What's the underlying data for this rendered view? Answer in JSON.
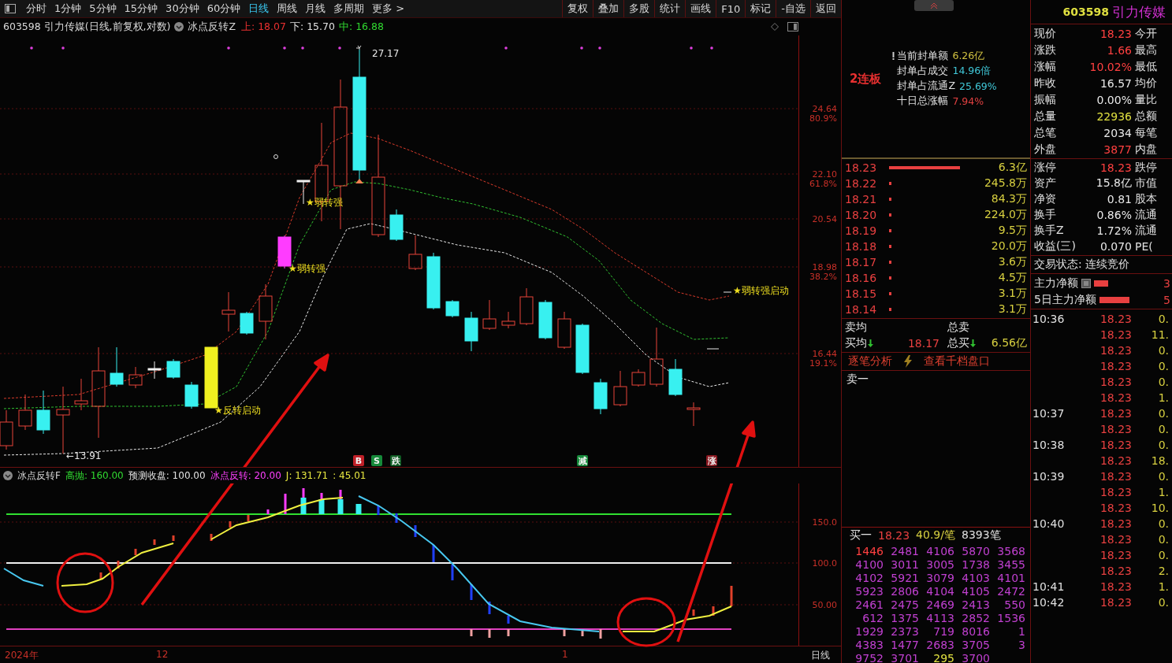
{
  "toolbar": {
    "periods": [
      {
        "label": "分时",
        "selected": false
      },
      {
        "label": "1分钟",
        "selected": false
      },
      {
        "label": "5分钟",
        "selected": false
      },
      {
        "label": "15分钟",
        "selected": false
      },
      {
        "label": "30分钟",
        "selected": false
      },
      {
        "label": "60分钟",
        "selected": false
      },
      {
        "label": "日线",
        "selected": true
      },
      {
        "label": "周线",
        "selected": false
      },
      {
        "label": "月线",
        "selected": false
      },
      {
        "label": "多周期",
        "selected": false
      },
      {
        "label": "更多 >",
        "selected": false
      }
    ],
    "actions": [
      "复权",
      "叠加",
      "多股",
      "统计",
      "画线",
      "F10",
      "标记",
      "-自选",
      "返回"
    ]
  },
  "chart_header": {
    "title": "603598 引力传媒(日线,前复权,对数)",
    "indicator": "冰点反转Z",
    "values": [
      {
        "text": "上: 18.07",
        "color": "#e83030"
      },
      {
        "text": "下: 15.70",
        "color": "#e0e0e0"
      },
      {
        "text": "中: 16.88",
        "color": "#30d830"
      }
    ]
  },
  "main_chart": {
    "y_axis": [
      {
        "price": "24.64",
        "ratio": "80.9%"
      },
      {
        "price": "22.10",
        "ratio": "61.8%"
      },
      {
        "price": "20.54"
      },
      {
        "price": "18.98",
        "ratio": "38.2%"
      },
      {
        "price": "16.44",
        "ratio": "19.1%"
      }
    ],
    "labels": [
      {
        "kind": "peak",
        "text": "27.17"
      },
      {
        "kind": "low",
        "text": "←13.91"
      },
      {
        "kind": "star",
        "text": "★弱转强"
      },
      {
        "kind": "star",
        "text": "★弱转强"
      },
      {
        "kind": "star",
        "text": "★反转启动"
      },
      {
        "kind": "star",
        "text": "★弱转强启动"
      }
    ],
    "signals": [
      {
        "text": "B",
        "color": "#c02028"
      },
      {
        "text": "S",
        "color": "#168a3a"
      },
      {
        "text": "跌",
        "color": "#0e5a22"
      },
      {
        "text": "减",
        "color": "#168a3a"
      },
      {
        "text": "涨",
        "color": "#8a1820"
      }
    ]
  },
  "indicator": {
    "name": "冰点反转F",
    "values": [
      {
        "text": "高抛: 160.00",
        "color": "#30d830"
      },
      {
        "text": "预测收盘: 100.00",
        "color": "#e0e0e0"
      },
      {
        "text": "冰点反转: 20.00",
        "color": "#ff40ff"
      },
      {
        "text": "J: 131.71",
        "color": "#e8e840"
      },
      {
        "text": ": 45.01",
        "color": "#e8e840"
      }
    ],
    "y_axis": [
      "150.0",
      "100.0",
      "50.00"
    ]
  },
  "x_axis": {
    "labels": [
      "2024年",
      "12",
      "1"
    ],
    "period": "日线"
  },
  "seal": {
    "badge": "2连板",
    "rows": [
      {
        "label": "当前封单额",
        "value": "6.26亿",
        "color": "#d0c040"
      },
      {
        "label": "封单占成交",
        "value": "14.96倍",
        "color": "#40c8d8"
      },
      {
        "label": "封单占流通Z",
        "value": "25.69%",
        "color": "#40c8d8"
      },
      {
        "label": "十日总涨幅",
        "value": "7.94%",
        "color": "#e04040"
      }
    ]
  },
  "quote": {
    "code": "603598",
    "name": "引力传媒",
    "stats": [
      {
        "label": "现价",
        "value": "18.23",
        "color": "#ff4040",
        "label2": "今开"
      },
      {
        "label": "涨跌",
        "value": "1.66",
        "color": "#ff4040",
        "label2": "最高"
      },
      {
        "label": "涨幅",
        "value": "10.02%",
        "color": "#ff4040",
        "label2": "最低"
      },
      {
        "label": "昨收",
        "value": "16.57",
        "color": "#e8e8e8",
        "label2": "均价"
      },
      {
        "label": "振幅",
        "value": "0.00%",
        "color": "#e8e8e8",
        "label2": "量比"
      },
      {
        "label": "总量",
        "value": "22936",
        "color": "#e0e040",
        "label2": "总额"
      },
      {
        "label": "总笔",
        "value": "2034",
        "color": "#e8e8e8",
        "label2": "每笔"
      },
      {
        "label": "外盘",
        "value": "3877",
        "color": "#ff4040",
        "label2": "内盘"
      }
    ],
    "stats2": [
      {
        "label": "涨停",
        "value": "18.23",
        "color": "#ff4040",
        "label2": "跌停"
      },
      {
        "label": "资产",
        "value": "15.8亿",
        "color": "#e8e8e8",
        "label2": "市值"
      },
      {
        "label": "净资",
        "value": "0.81",
        "color": "#e8e8e8",
        "label2": "股本"
      },
      {
        "label": "换手",
        "value": "0.86%",
        "color": "#e8e8e8",
        "label2": "流通"
      },
      {
        "label": "换手Z",
        "value": "1.72%",
        "color": "#e8e8e8",
        "label2": "流通"
      },
      {
        "label": "收益(三)",
        "value": "0.070",
        "color": "#e8e8e8",
        "label2": "PE("
      }
    ],
    "status": "交易状态: 连续竞价",
    "flows": [
      {
        "label": "主力净额",
        "value": "3"
      },
      {
        "label": "5日主力净额",
        "value": "5"
      }
    ]
  },
  "order_book": {
    "asks": [
      {
        "price": "18.23",
        "amount": "6.3亿"
      },
      {
        "price": "18.22",
        "amount": "245.8万"
      },
      {
        "price": "18.21",
        "amount": "84.3万"
      },
      {
        "price": "18.20",
        "amount": "224.0万"
      },
      {
        "price": "18.19",
        "amount": "9.5万"
      },
      {
        "price": "18.18",
        "amount": "20.0万"
      },
      {
        "price": "18.17",
        "amount": "3.6万"
      },
      {
        "price": "18.16",
        "amount": "4.5万"
      },
      {
        "price": "18.15",
        "amount": "3.1万"
      },
      {
        "price": "18.14",
        "amount": "3.1万"
      }
    ],
    "sell_avg_label": "卖均",
    "sell_total_label": "总卖",
    "buy_avg_label": "买均",
    "buy_avg": "18.17",
    "buy_total_label": "总买",
    "buy_total": "6.56亿",
    "links": [
      "逐笔分析",
      "查看千档盘口"
    ],
    "sell1": "卖一",
    "buy1": {
      "label": "买一",
      "price": "18.23",
      "per": "40.9/笔",
      "count": "8393笔"
    },
    "queue": [
      [
        {
          "text": "1446",
          "color": "#ff4040"
        },
        {
          "text": "2481",
          "color": "#c040d0"
        },
        {
          "text": "4106",
          "color": "#c040d0"
        },
        {
          "text": "5870",
          "color": "#c040d0"
        },
        {
          "text": "3568",
          "color": "#c040d0"
        }
      ],
      [
        {
          "text": "4100",
          "color": "#c040d0"
        },
        {
          "text": "3011",
          "color": "#c040d0"
        },
        {
          "text": "3005",
          "color": "#c040d0"
        },
        {
          "text": "1738",
          "color": "#c040d0"
        },
        {
          "text": "3455",
          "color": "#c040d0"
        }
      ],
      [
        {
          "text": "4102",
          "color": "#c040d0"
        },
        {
          "text": "5921",
          "color": "#c040d0"
        },
        {
          "text": "3079",
          "color": "#c040d0"
        },
        {
          "text": "4103",
          "color": "#c040d0"
        },
        {
          "text": "4101",
          "color": "#c040d0"
        }
      ],
      [
        {
          "text": "5923",
          "color": "#c040d0"
        },
        {
          "text": "2806",
          "color": "#c040d0"
        },
        {
          "text": "4104",
          "color": "#c040d0"
        },
        {
          "text": "4105",
          "color": "#c040d0"
        },
        {
          "text": "2472",
          "color": "#c040d0"
        }
      ],
      [
        {
          "text": "2461",
          "color": "#c040d0"
        },
        {
          "text": "2475",
          "color": "#c040d0"
        },
        {
          "text": "2469",
          "color": "#c040d0"
        },
        {
          "text": "2413",
          "color": "#c040d0"
        },
        {
          "text": "550",
          "color": "#c040d0"
        }
      ],
      [
        {
          "text": "612",
          "color": "#c040d0"
        },
        {
          "text": "1375",
          "color": "#c040d0"
        },
        {
          "text": "4113",
          "color": "#c040d0"
        },
        {
          "text": "2852",
          "color": "#c040d0"
        },
        {
          "text": "1536",
          "color": "#c040d0"
        }
      ],
      [
        {
          "text": "1929",
          "color": "#c040d0"
        },
        {
          "text": "2373",
          "color": "#c040d0"
        },
        {
          "text": "719",
          "color": "#c040d0"
        },
        {
          "text": "8016",
          "color": "#c040d0"
        },
        {
          "text": "1",
          "color": "#c040d0"
        }
      ],
      [
        {
          "text": "4383",
          "color": "#c040d0"
        },
        {
          "text": "1477",
          "color": "#c040d0"
        },
        {
          "text": "2683",
          "color": "#c040d0"
        },
        {
          "text": "3705",
          "color": "#c040d0"
        },
        {
          "text": "3",
          "color": "#c040d0"
        }
      ],
      [
        {
          "text": "9752",
          "color": "#c040d0"
        },
        {
          "text": "3701",
          "color": "#c040d0"
        },
        {
          "text": "295",
          "color": "#e0e040"
        },
        {
          "text": "3700",
          "color": "#c040d0"
        }
      ]
    ]
  },
  "ticks": [
    {
      "time": "10:36",
      "price": "18.23",
      "volume": "0."
    },
    {
      "price": "18.23",
      "volume": "11."
    },
    {
      "price": "18.23",
      "volume": "0."
    },
    {
      "price": "18.23",
      "volume": "0."
    },
    {
      "price": "18.23",
      "volume": "0."
    },
    {
      "price": "18.23",
      "volume": "1."
    },
    {
      "time": "10:37",
      "price": "18.23",
      "volume": "0."
    },
    {
      "price": "18.23",
      "volume": "0."
    },
    {
      "time": "10:38",
      "price": "18.23",
      "volume": "0."
    },
    {
      "price": "18.23",
      "volume": "18."
    },
    {
      "time": "10:39",
      "price": "18.23",
      "volume": "0."
    },
    {
      "price": "18.23",
      "volume": "1."
    },
    {
      "price": "18.23",
      "volume": "10."
    },
    {
      "time": "10:40",
      "price": "18.23",
      "volume": "0."
    },
    {
      "price": "18.23",
      "volume": "0."
    },
    {
      "price": "18.23",
      "volume": "0."
    },
    {
      "price": "18.23",
      "volume": "2."
    },
    {
      "time": "10:41",
      "price": "18.23",
      "volume": "1."
    },
    {
      "time": "10:42",
      "price": "18.23",
      "volume": "0."
    }
  ]
}
